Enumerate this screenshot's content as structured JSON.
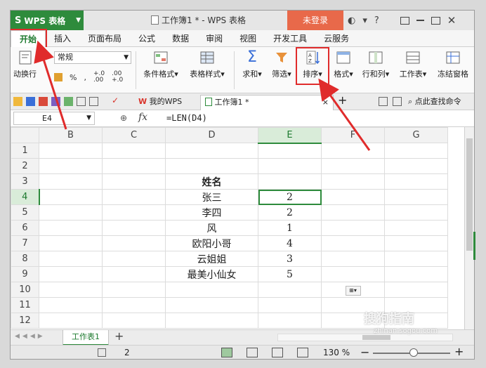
{
  "titlebar": {
    "app_name": "WPS 表格",
    "doc_title": "工作簿1 * - WPS 表格",
    "login_label": "未登录",
    "help_label": "?"
  },
  "menu": {
    "tabs": [
      "开始",
      "插入",
      "页面布局",
      "公式",
      "数据",
      "审阅",
      "视图",
      "开发工具",
      "云服务"
    ],
    "active": "开始"
  },
  "ribbon": {
    "wrap_label": "动换行",
    "style_select": "常规",
    "percent": "%",
    "dec_inc": "+.0\n.00",
    "dec_dec": ".00\n+.0",
    "cond_format": "条件格式",
    "table_style": "表格样式",
    "sum": "求和",
    "filter": "筛选",
    "sort": "排序",
    "format": "格式",
    "row_col": "行和列",
    "worksheet": "工作表",
    "freeze": "冻结窗格"
  },
  "quickbar": {
    "wps_tab": "我的WPS",
    "book_tab": "工作簿1 *",
    "search_cmd": "点此查找命令"
  },
  "formulabar": {
    "cell_ref": "E4",
    "fx": "fx",
    "formula": "=LEN(D4)"
  },
  "grid": {
    "columns": [
      "B",
      "C",
      "D",
      "E",
      "F",
      "G"
    ],
    "rows": [
      "1",
      "2",
      "3",
      "4",
      "5",
      "6",
      "7",
      "8",
      "9",
      "10",
      "11",
      "12"
    ],
    "header_name": "姓名",
    "names": [
      "张三",
      "李四",
      "风",
      "欧阳小哥",
      "云姐姐",
      "最美小仙女"
    ],
    "lengths": [
      "2",
      "2",
      "1",
      "4",
      "3",
      "5"
    ]
  },
  "sheets": {
    "active": "工作表1",
    "add": "+"
  },
  "status": {
    "count": "2",
    "zoom": "130 %",
    "minus": "−",
    "plus": "+"
  },
  "watermark": {
    "line1": "搜狗指南",
    "line2": "zhinan.sogou.com"
  },
  "colors": {
    "brand": "#2e8b3c",
    "login": "#e8694a",
    "annotation": "#e02b2b"
  }
}
